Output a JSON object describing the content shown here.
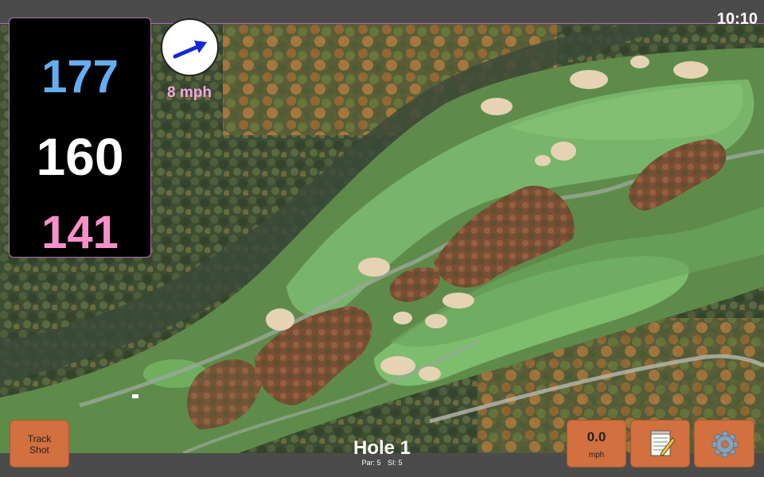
{
  "status": {
    "time": "10:10"
  },
  "distances": {
    "back": "177",
    "middle": "160",
    "front": "141"
  },
  "wind": {
    "speed": "8 mph",
    "icon": "wind-direction-arrow-icon"
  },
  "hole": {
    "title": "Hole 1",
    "par": "Par: 5",
    "stroke_index": "SI: 5"
  },
  "buttons": {
    "track_shot_line1": "Track",
    "track_shot_line2": "Shot",
    "speed_value": "0.0",
    "speed_unit": "mph",
    "notes_icon": "notepad-icon",
    "settings_icon": "gear-icon"
  },
  "colors": {
    "back_distance": "#64adf2",
    "middle_distance": "#ffffff",
    "front_distance": "#f790c9",
    "button": "#d2703f",
    "accent_border": "#b06fb5"
  }
}
